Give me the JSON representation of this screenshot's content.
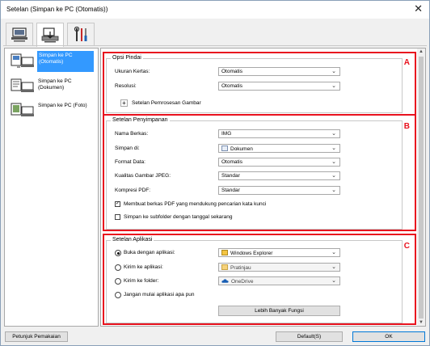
{
  "window": {
    "title": "Setelan (Simpan ke PC (Otomatis))",
    "close_glyph": "✕"
  },
  "toolbar": {
    "tabs": [
      "scan-from-computer-icon",
      "scan-from-panel-icon",
      "general-settings-icon"
    ]
  },
  "nav": {
    "items": [
      {
        "label": "Simpan ke PC (Otomatis)",
        "icon": "auto-scan-icon",
        "active": true
      },
      {
        "label": "Simpan ke PC (Dokumen)",
        "icon": "document-scan-icon",
        "active": false
      },
      {
        "label": "Simpan ke PC (Foto)",
        "icon": "photo-scan-icon",
        "active": false
      }
    ]
  },
  "sections": {
    "A": {
      "letter": "A",
      "title": "Opsi Pindai",
      "paper_size_label": "Ukuran Kertas:",
      "paper_size_value": "Otomatis",
      "resolution_label": "Resolusi:",
      "resolution_value": "Otomatis",
      "image_processing_label": "Setelan Pemrosesan Gambar"
    },
    "B": {
      "letter": "B",
      "title": "Setelan Penyimpanan",
      "file_name_label": "Nama Berkas:",
      "file_name_value": "IMG",
      "save_in_label": "Simpan di:",
      "save_in_value": "Dokumen",
      "data_format_label": "Format Data:",
      "data_format_value": "Otomatis",
      "jpeg_quality_label": "Kualitas Gambar JPEG:",
      "jpeg_quality_value": "Standar",
      "pdf_compression_label": "Kompresi PDF:",
      "pdf_compression_value": "Standar",
      "searchable_pdf_label": "Membuat berkas PDF yang mendukung pencarian kata kunci",
      "searchable_pdf_checked": true,
      "subfolder_label": "Simpan ke subfolder dengan tanggal sekarang",
      "subfolder_checked": false
    },
    "C": {
      "letter": "C",
      "title": "Setelan Aplikasi",
      "open_app_label": "Buka dengan aplikasi:",
      "open_app_value": "Windows Explorer",
      "send_app_label": "Kirim ke aplikasi:",
      "send_app_value": "Pratinjau",
      "send_folder_label": "Kirim ke folder:",
      "send_folder_value": "OneDrive",
      "no_app_label": "Jangan mulai aplikasi apa pun",
      "more_functions_label": "Lebih Banyak Fungsi",
      "selected_option": "open_app"
    }
  },
  "footer": {
    "instructions_label": "Petunjuk Pemakaian",
    "defaults_label": "Default(S)",
    "ok_label": "OK"
  },
  "colors": {
    "highlight": "#e8121e",
    "selection": "#3399ff"
  }
}
